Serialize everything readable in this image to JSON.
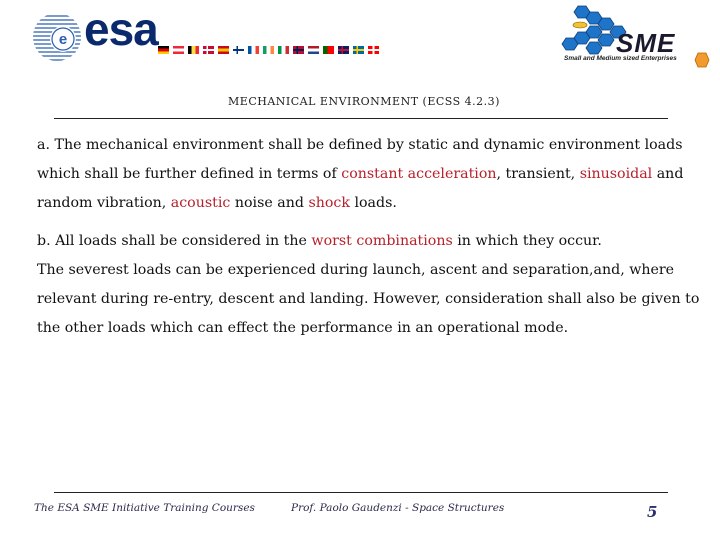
{
  "header": {
    "esa_logo_text": "esa",
    "flags": [
      {
        "name": "germany",
        "colors": [
          "#000000",
          "#dd0000",
          "#ffce00"
        ],
        "dir": "h"
      },
      {
        "name": "austria",
        "colors": [
          "#ed2939",
          "#ffffff",
          "#ed2939"
        ],
        "dir": "h"
      },
      {
        "name": "belgium",
        "colors": [
          "#000000",
          "#fae042",
          "#ed2939"
        ],
        "dir": "v"
      },
      {
        "name": "denmark",
        "colors": [
          "#c60c30",
          "#ffffff"
        ],
        "dir": "cross"
      },
      {
        "name": "spain",
        "colors": [
          "#c60b1e",
          "#ffc400",
          "#c60b1e"
        ],
        "dir": "h"
      },
      {
        "name": "finland",
        "colors": [
          "#ffffff",
          "#003580"
        ],
        "dir": "cross"
      },
      {
        "name": "france",
        "colors": [
          "#0055a4",
          "#ffffff",
          "#ef4135"
        ],
        "dir": "v"
      },
      {
        "name": "ireland",
        "colors": [
          "#169b62",
          "#ffffff",
          "#ff883e"
        ],
        "dir": "v"
      },
      {
        "name": "italy",
        "colors": [
          "#009246",
          "#ffffff",
          "#ce2b37"
        ],
        "dir": "v"
      },
      {
        "name": "norway",
        "colors": [
          "#ba0c2f",
          "#00205b"
        ],
        "dir": "cross"
      },
      {
        "name": "netherlands",
        "colors": [
          "#ae1c28",
          "#ffffff",
          "#21468b"
        ],
        "dir": "h"
      },
      {
        "name": "portugal",
        "colors": [
          "#006600",
          "#ff0000"
        ],
        "dir": "split"
      },
      {
        "name": "united-kingdom",
        "colors": [
          "#012169",
          "#c8102e"
        ],
        "dir": "cross"
      },
      {
        "name": "sweden",
        "colors": [
          "#006aa7",
          "#fecc00"
        ],
        "dir": "cross"
      },
      {
        "name": "switzerland",
        "colors": [
          "#ff0000",
          "#ffffff"
        ],
        "dir": "swiss"
      }
    ],
    "sme_logo_text": "SME",
    "sme_subtitle": "Small and Medium sized Enterprises"
  },
  "slide": {
    "title": "MECHANICAL ENVIRONMENT (ECSS 4.2.3)",
    "highlight_color": "#b8202a",
    "para_a": {
      "t1": "a. The mechanical environment shall be defined by static and dynamic environment loads which shall be further defined in terms of ",
      "h1": "constant acceleration",
      "t2": ", transient, ",
      "h2": "sinusoidal",
      "t3": " and random vibration, ",
      "h3": "acoustic",
      "t4": " noise and ",
      "h4": "shock",
      "t5": " loads."
    },
    "para_b": {
      "t1": "b. All loads shall be considered in the ",
      "h1": "worst combinations",
      "t2": " in which they occur.",
      "line2": "The severest loads can be experienced during launch, ascent and separation,and, where relevant during re-entry, descent and landing. However, consideration shall also be given to the other loads which can effect the performance in an operational mode."
    }
  },
  "footer": {
    "left": "The ESA SME Initiative Training Courses",
    "middle": "Prof. Paolo Gaudenzi  -  Space Structures",
    "page_number": "5"
  }
}
